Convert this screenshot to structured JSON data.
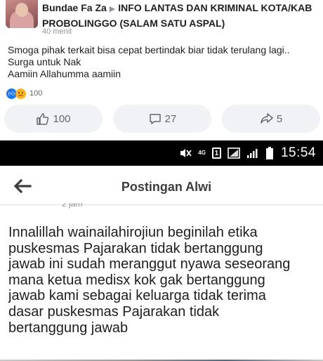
{
  "post": {
    "author": "Bundae Fa Za",
    "group": "INFO LANTAS DAN KRIMINAL KOTA/KAB PROBOLINGGO (SALAM SATU ASPAL)",
    "timestamp": "40 menit",
    "lines": [
      "Smoga pihak terkait bisa cepat bertindak biar tidak terulang lagi..",
      "Surga untuk Nak",
      "Aamiin Allahumma aamiin"
    ],
    "reaction_count": "100",
    "actions": {
      "like_count": "100",
      "comment_count": "27",
      "share_count": "5"
    }
  },
  "status_bar": {
    "network": "4G",
    "sim": "1",
    "time": "15:54"
  },
  "post_page": {
    "title": "Postingan Alwi",
    "cut_timestamp": "2 jam",
    "body_lines": [
      "Innalillah wainailahirojiun beginilah etika",
      "puskesmas Pajarakan  tidak bertanggung",
      "jawab ini sudah meranggut nyawa seseorang",
      "mana ketua medisx kok gak bertanggung",
      "jawab kami sebagai keluarga tidak terima",
      "dasar puskesmas Pajarakan tidak",
      "bertanggung jawab"
    ]
  },
  "colors": {
    "fb_blue": "#1877f2",
    "text_primary": "#1c1e21",
    "text_secondary": "#65676b",
    "button_bg": "#f0f2f5"
  }
}
